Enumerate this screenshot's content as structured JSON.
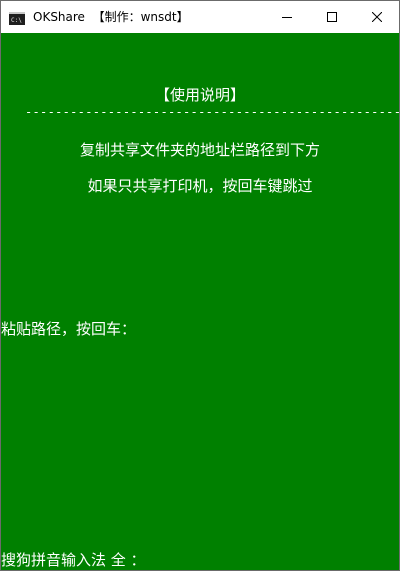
{
  "window": {
    "title": "OKShare  【制作：wnsdt】",
    "app_icon": "console-icon",
    "controls": {
      "minimize_icon": "minimize-icon",
      "maximize_icon": "maximize-icon",
      "close_icon": "close-icon"
    }
  },
  "console": {
    "background_color": "#008000",
    "text_color": "#ffffff",
    "heading": "【使用说明】",
    "divider": "------------------------------------------------------",
    "instruction_1": "复制共享文件夹的地址栏路径到下方",
    "instruction_2": "如果只共享打印机，按回车键跳过",
    "prompt": "粘贴路径，按回车：",
    "ime_status": "搜狗拼音输入法 全 ："
  }
}
